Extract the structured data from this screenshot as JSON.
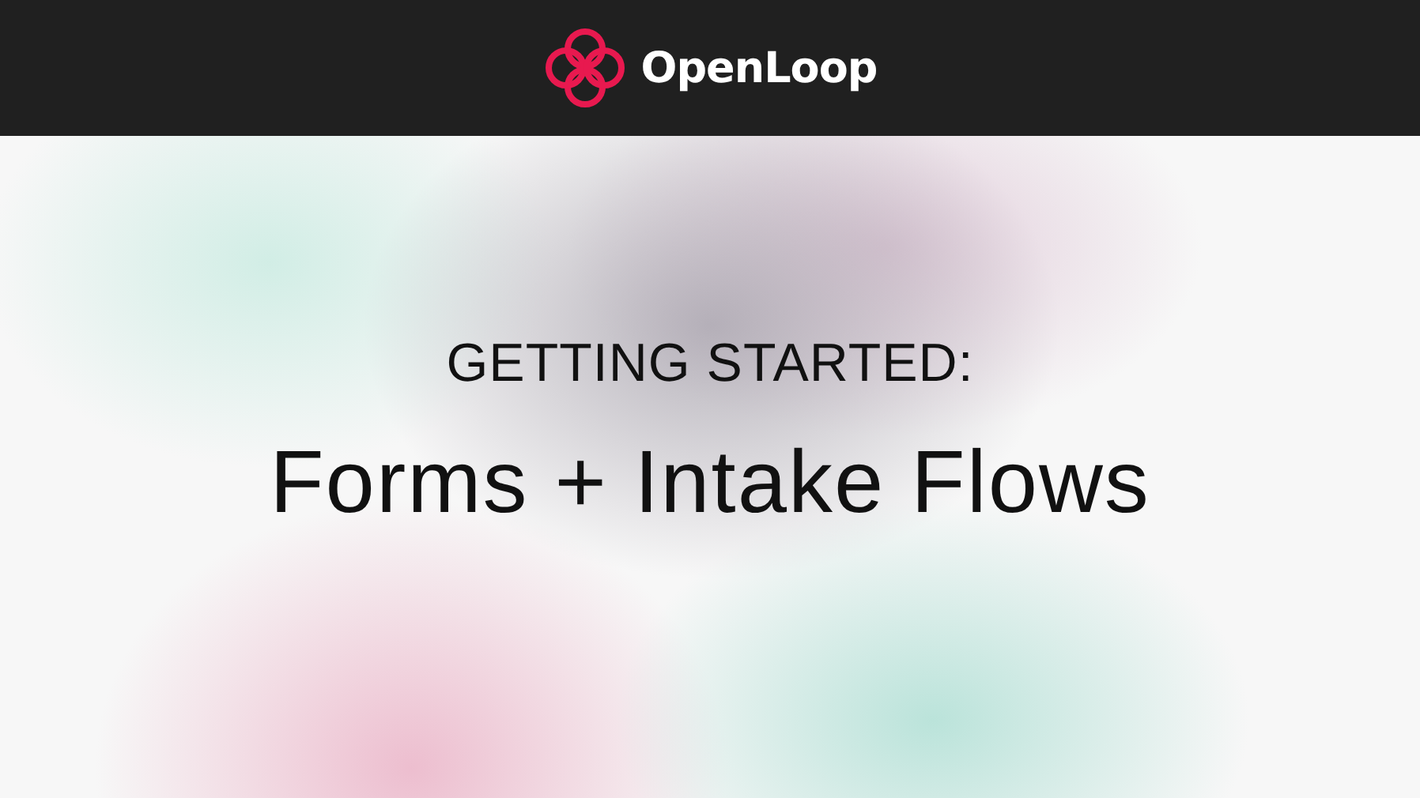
{
  "header": {
    "brand": "OpenLoop"
  },
  "hero": {
    "eyebrow": "GETTING STARTED:",
    "title": "Forms + Intake Flows"
  }
}
